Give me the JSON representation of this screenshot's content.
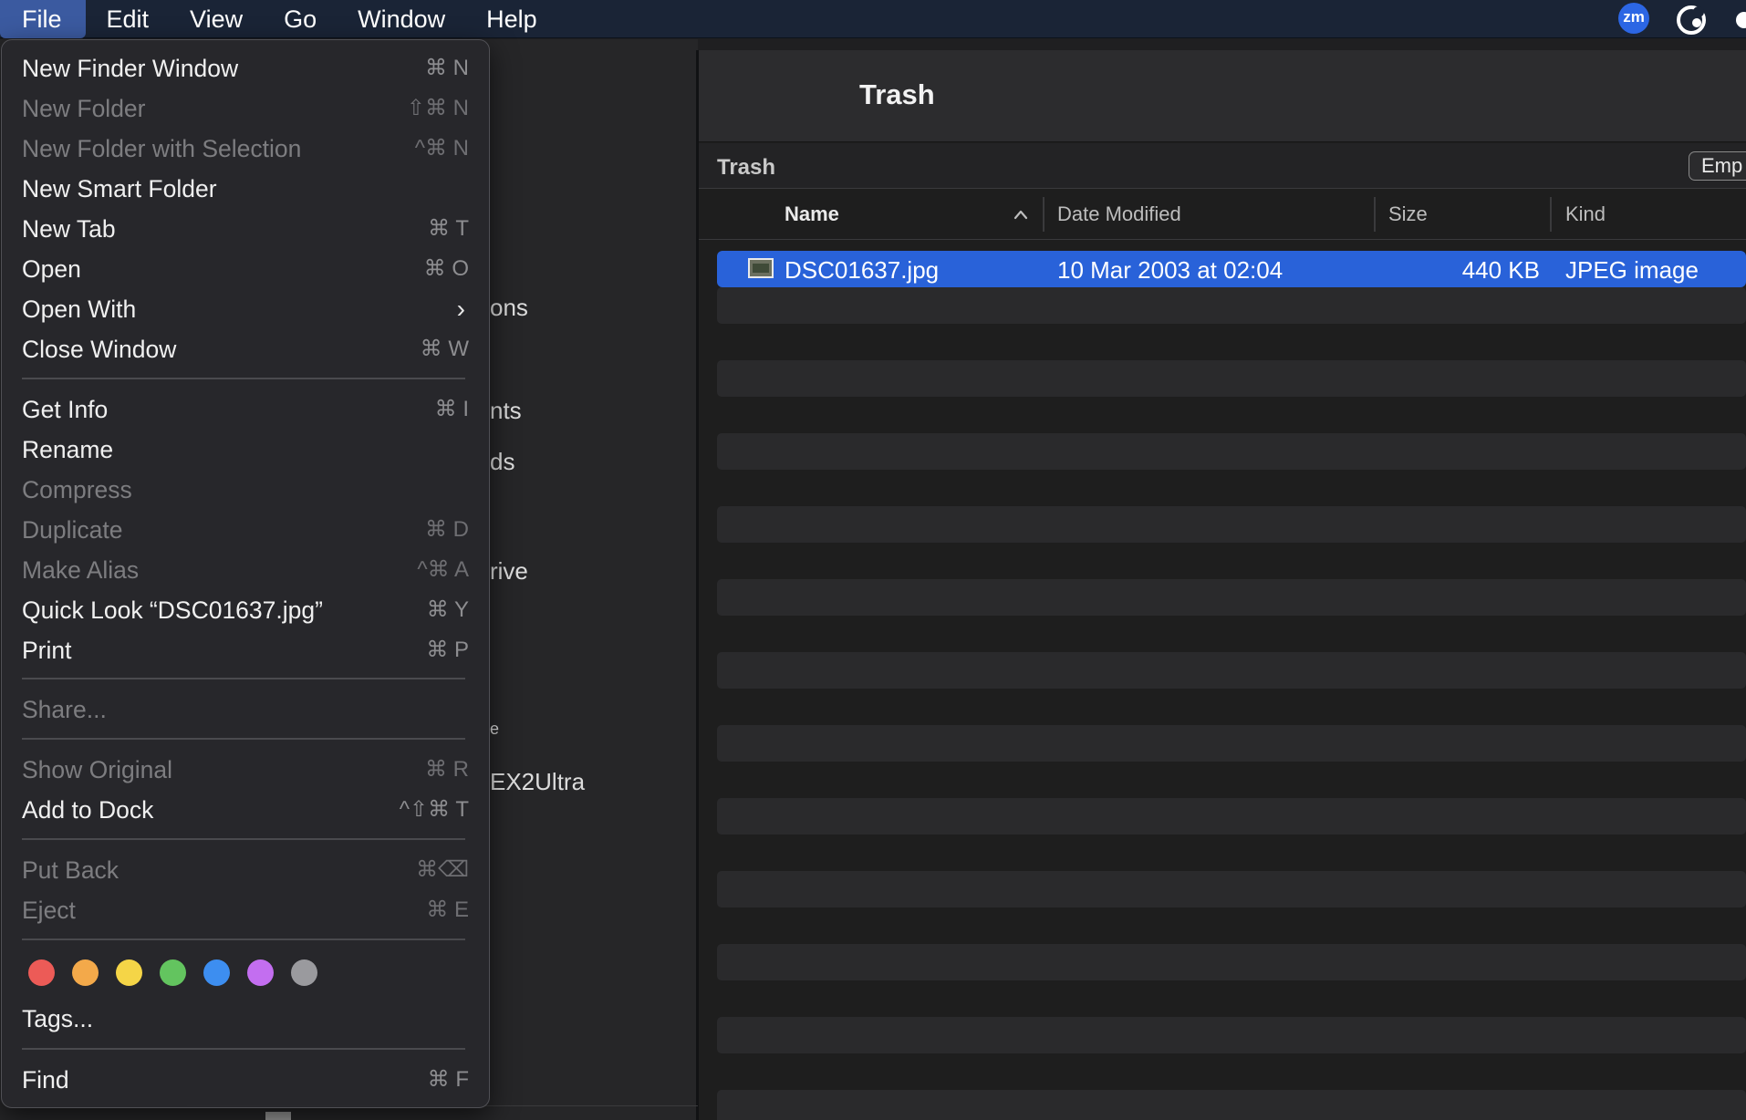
{
  "menubar": {
    "items": [
      "File",
      "Edit",
      "View",
      "Go",
      "Window",
      "Help"
    ],
    "active": "File",
    "status_zoom_label": "zm"
  },
  "finder": {
    "window_title": "Trash",
    "path_title": "Trash",
    "empty_button": "Emp",
    "sidebar_fragments": [
      "ons",
      "nts",
      "ds",
      "rive",
      "e",
      "EX2Ultra"
    ],
    "columns": {
      "name": "Name",
      "date": "Date Modified",
      "size": "Size",
      "kind": "Kind"
    },
    "files": [
      {
        "name": "DSC01637.jpg",
        "date": "10 Mar 2003 at 02:04",
        "size": "440 KB",
        "kind": "JPEG image"
      }
    ]
  },
  "file_menu": {
    "items": [
      {
        "label": "New Finder Window",
        "shortcut": "⌘ N",
        "enabled": true
      },
      {
        "label": "New Folder",
        "shortcut": "⇧⌘ N",
        "enabled": false
      },
      {
        "label": "New Folder with Selection",
        "shortcut": "^⌘ N",
        "enabled": false
      },
      {
        "label": "New Smart Folder",
        "shortcut": "",
        "enabled": true
      },
      {
        "label": "New Tab",
        "shortcut": "⌘ T",
        "enabled": true
      },
      {
        "label": "Open",
        "shortcut": "⌘ O",
        "enabled": true
      },
      {
        "label": "Open With",
        "shortcut": "›",
        "enabled": true
      },
      {
        "label": "Close Window",
        "shortcut": "⌘ W",
        "enabled": true
      },
      {
        "label": "Get Info",
        "shortcut": "⌘ I",
        "enabled": true
      },
      {
        "label": "Rename",
        "shortcut": "",
        "enabled": true
      },
      {
        "label": "Compress",
        "shortcut": "",
        "enabled": false
      },
      {
        "label": "Duplicate",
        "shortcut": "⌘ D",
        "enabled": false
      },
      {
        "label": "Make Alias",
        "shortcut": "^⌘ A",
        "enabled": false
      },
      {
        "label": "Quick Look “DSC01637.jpg”",
        "shortcut": "⌘ Y",
        "enabled": true
      },
      {
        "label": "Print",
        "shortcut": "⌘ P",
        "enabled": true
      },
      {
        "label": "Share...",
        "shortcut": "",
        "enabled": false
      },
      {
        "label": "Show Original",
        "shortcut": "⌘ R",
        "enabled": false
      },
      {
        "label": "Add to Dock",
        "shortcut": "^⇧⌘ T",
        "enabled": true
      },
      {
        "label": "Put Back",
        "shortcut": "⌘⌫",
        "enabled": false
      },
      {
        "label": "Eject",
        "shortcut": "⌘ E",
        "enabled": false
      },
      {
        "label": "Tags...",
        "shortcut": "",
        "enabled": true
      },
      {
        "label": "Find",
        "shortcut": "⌘ F",
        "enabled": true
      }
    ],
    "tag_colors": [
      "#ec5b57",
      "#f3a94a",
      "#f5d547",
      "#63c45f",
      "#3d8ef0",
      "#c36ef0",
      "#9a9a9e"
    ]
  }
}
